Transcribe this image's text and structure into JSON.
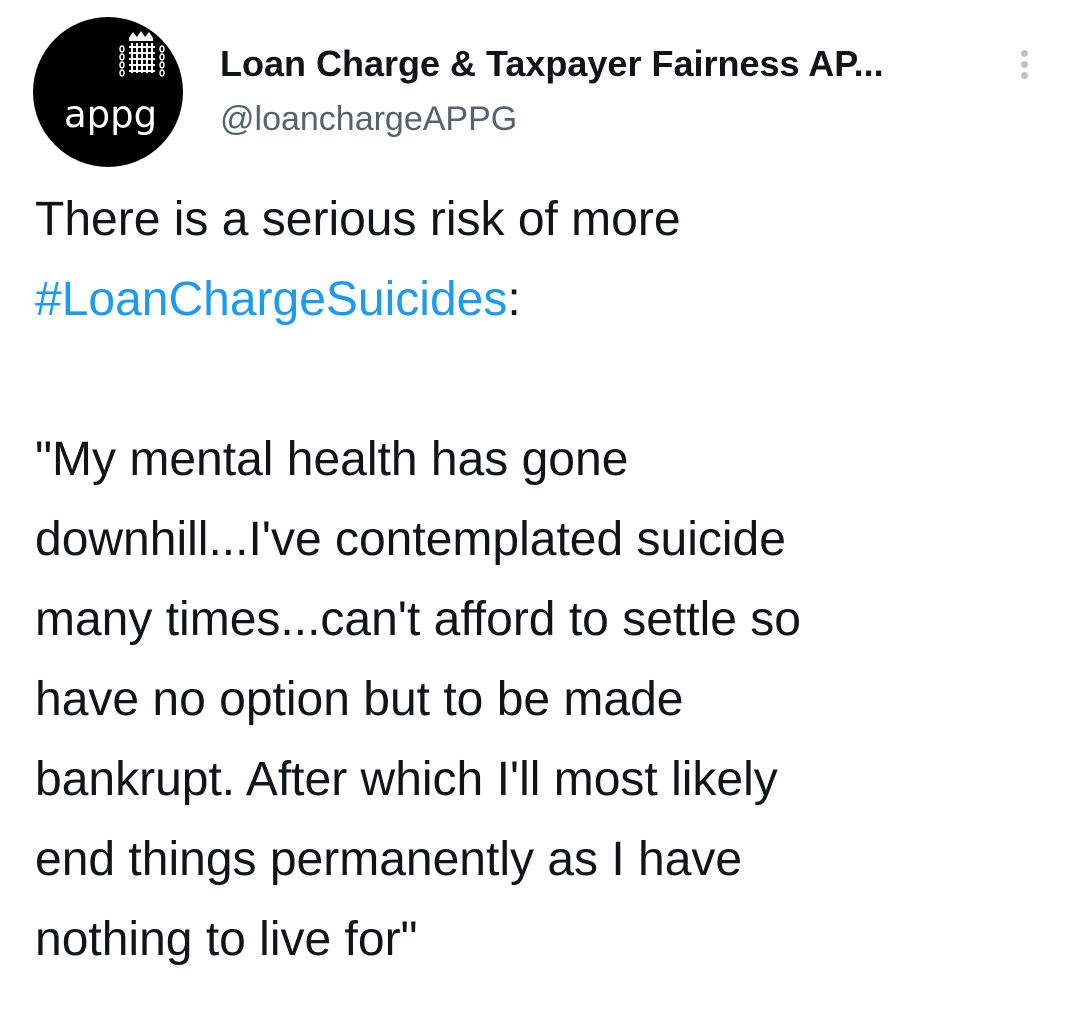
{
  "account": {
    "display_name": "Loan Charge & Taxpayer Fairness AP...",
    "handle": "@loanchargeAPPG",
    "avatar_text": "appg"
  },
  "tweet": {
    "line1": "There is a serious risk of more",
    "hashtag": "#LoanChargeSuicides",
    "after_hashtag": ":",
    "quote_lines": [
      "\"My mental health has gone",
      "downhill...I've contemplated suicide",
      "many times...can't afford to settle so",
      "have no option but to be made",
      "bankrupt. After which I'll most likely",
      "end things permanently as I have",
      "nothing to live for\""
    ]
  },
  "colors": {
    "text": "#0f1419",
    "secondary": "#536471",
    "link": "#1d9bf0",
    "avatar_bg": "#000000"
  },
  "icons": {
    "more": "more-vertical-icon",
    "logo": "portcullis-logo-icon"
  }
}
